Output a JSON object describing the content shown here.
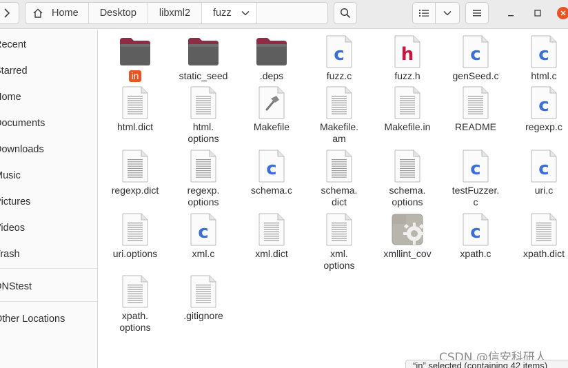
{
  "header": {
    "path": [
      "Home",
      "Desktop",
      "libxml2",
      "fuzz"
    ]
  },
  "sidebar": {
    "items": [
      "Recent",
      "Starred",
      "Home",
      "Documents",
      "Downloads",
      "Music",
      "Pictures",
      "Videos",
      "Trash",
      "DNStest",
      "Other Locations"
    ]
  },
  "files": [
    {
      "name": "in",
      "type": "folder",
      "selected": true
    },
    {
      "name": "static_seed",
      "type": "folder"
    },
    {
      "name": ".deps",
      "type": "folder"
    },
    {
      "name": "fuzz.c",
      "type": "c"
    },
    {
      "name": "fuzz.h",
      "type": "h"
    },
    {
      "name": "genSeed.c",
      "type": "c"
    },
    {
      "name": "html.c",
      "type": "c"
    },
    {
      "name": "html.dict",
      "type": "text"
    },
    {
      "name": "html.\noptions",
      "type": "text"
    },
    {
      "name": "Makefile",
      "type": "makefile"
    },
    {
      "name": "Makefile.\nam",
      "type": "text"
    },
    {
      "name": "Makefile.in",
      "type": "text"
    },
    {
      "name": "README",
      "type": "text"
    },
    {
      "name": "regexp.c",
      "type": "c"
    },
    {
      "name": "regexp.dict",
      "type": "text"
    },
    {
      "name": "regexp.\noptions",
      "type": "text"
    },
    {
      "name": "schema.c",
      "type": "c"
    },
    {
      "name": "schema.\ndict",
      "type": "text"
    },
    {
      "name": "schema.\noptions",
      "type": "text"
    },
    {
      "name": "testFuzzer.\nc",
      "type": "c"
    },
    {
      "name": "uri.c",
      "type": "c"
    },
    {
      "name": "uri.options",
      "type": "text"
    },
    {
      "name": "xml.c",
      "type": "c"
    },
    {
      "name": "xml.dict",
      "type": "text"
    },
    {
      "name": "xml.\noptions",
      "type": "text"
    },
    {
      "name": "xmllint_cov",
      "type": "executable"
    },
    {
      "name": "xpath.c",
      "type": "c"
    },
    {
      "name": "xpath.dict",
      "type": "text"
    },
    {
      "name": "xpath.\noptions",
      "type": "text"
    },
    {
      "name": ".gitignore",
      "type": "text"
    }
  ],
  "status": "“in” selected  (containing 42 items)",
  "watermark": "CSDN @信安科研人",
  "colors": {
    "accent": "#e95420",
    "c_letter": "#3a6fd8",
    "h_letter": "#c7163f",
    "folder": "#5e5e5e",
    "folder_tab": "#8e2c45"
  }
}
